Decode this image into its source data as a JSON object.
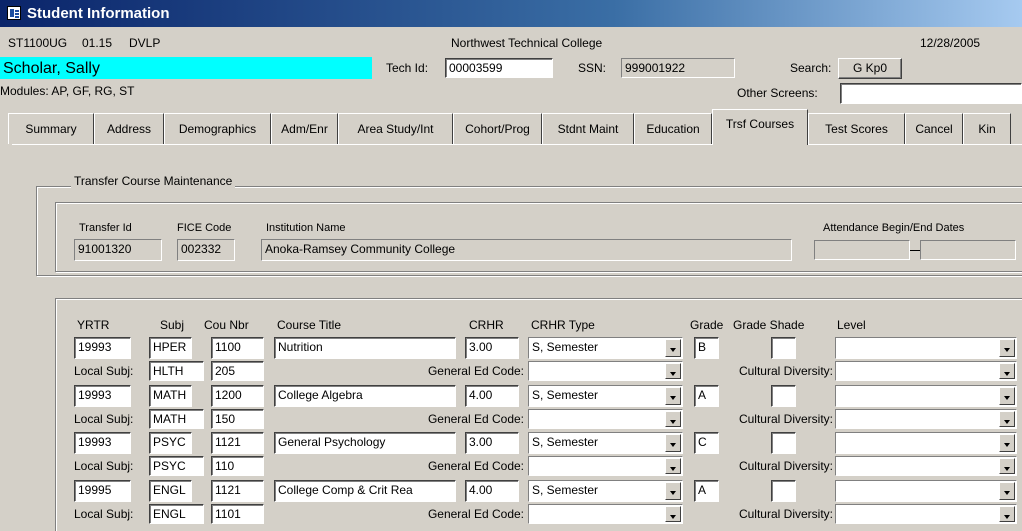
{
  "window": {
    "title": "Student Information"
  },
  "header": {
    "form_id": "ST1100UG",
    "version": "01.15",
    "env": "DVLP",
    "college": "Northwest Technical College",
    "date": "12/28/2005",
    "student_name": "Scholar, Sally",
    "tech_id_label": "Tech Id:",
    "tech_id": "00003599",
    "ssn_label": "SSN:",
    "ssn": "999001922",
    "search_label": "Search:",
    "search_button": "G Kp0",
    "modules": "Modules:  AP, GF, RG, ST",
    "other_screens_label": "Other Screens:",
    "other_screens": ""
  },
  "tabs": [
    {
      "label": "Summary"
    },
    {
      "label": "Address"
    },
    {
      "label": "Demographics"
    },
    {
      "label": "Adm/Enr"
    },
    {
      "label": "Area Study/Int"
    },
    {
      "label": "Cohort/Prog"
    },
    {
      "label": "Stdnt Maint"
    },
    {
      "label": "Education"
    },
    {
      "label": "Trsf Courses"
    },
    {
      "label": "Test Scores"
    },
    {
      "label": "Cancel"
    },
    {
      "label": "Kin"
    }
  ],
  "active_tab": "Trsf Courses",
  "transfer": {
    "group_label": "Transfer Course Maintenance",
    "transfer_id_label": "Transfer Id",
    "fice_label": "FICE Code",
    "institution_label": "Institution Name",
    "attendance_label": "Attendance Begin/End Dates",
    "transfer_id": "91001320",
    "fice": "002332",
    "institution": "Anoka-Ramsey Community College",
    "attendance_begin": "",
    "attendance_end": ""
  },
  "courses": {
    "headers": {
      "yrtr": "YRTR",
      "subj": "Subj",
      "cou_nbr": "Cou Nbr",
      "title": "Course Title",
      "crhr": "CRHR",
      "crhr_type": "CRHR Type",
      "grade": "Grade",
      "grade_shade": "Grade Shade",
      "level": "Level"
    },
    "local_subj_label": "Local Subj:",
    "gen_ed_label": "General Ed Code:",
    "cultural_label": "Cultural Diversity:",
    "rows": [
      {
        "yrtr": "19993",
        "subj": "HPER",
        "nbr": "1100",
        "title": "Nutrition",
        "crhr": "3.00",
        "type": "S, Semester",
        "grade": "B",
        "shade": "",
        "level": "",
        "local_subj": "HLTH",
        "local_nbr": "205",
        "gen_ed": "",
        "cultural": ""
      },
      {
        "yrtr": "19993",
        "subj": "MATH",
        "nbr": "1200",
        "title": "College Algebra",
        "crhr": "4.00",
        "type": "S, Semester",
        "grade": "A",
        "shade": "",
        "level": "",
        "local_subj": "MATH",
        "local_nbr": "150",
        "gen_ed": "",
        "cultural": ""
      },
      {
        "yrtr": "19993",
        "subj": "PSYC",
        "nbr": "1121",
        "title": "General Psychology",
        "crhr": "3.00",
        "type": "S, Semester",
        "grade": "C",
        "shade": "",
        "level": "",
        "local_subj": "PSYC",
        "local_nbr": "110",
        "gen_ed": "",
        "cultural": ""
      },
      {
        "yrtr": "19995",
        "subj": "ENGL",
        "nbr": "1121",
        "title": "College Comp & Crit Rea",
        "crhr": "4.00",
        "type": "S, Semester",
        "grade": "A",
        "shade": "",
        "level": "",
        "local_subj": "ENGL",
        "local_nbr": "1101",
        "gen_ed": "",
        "cultural": ""
      }
    ]
  },
  "colors": {
    "name_highlight": "#00ffff",
    "window_bg": "#d4d0c8",
    "title_bar": "#0a246a"
  }
}
